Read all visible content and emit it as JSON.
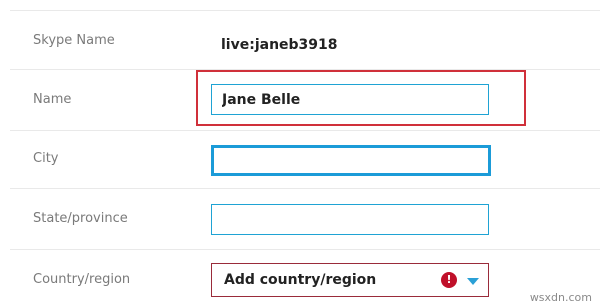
{
  "fields": {
    "skype_name": {
      "label": "Skype Name",
      "value": "live:janeb3918"
    },
    "name": {
      "label": "Name",
      "value": "Jane Belle"
    },
    "city": {
      "label": "City",
      "value": ""
    },
    "state": {
      "label": "State/province",
      "value": ""
    },
    "country": {
      "label": "Country/region",
      "value": "Add country/region",
      "error_icon": "exclamation-icon",
      "dropdown_icon": "chevron-down-icon"
    }
  },
  "watermark": "wsxdn.com",
  "colors": {
    "highlight_box": "#d0303a",
    "input_border": "#1fa3d4",
    "error": "#c0102a",
    "caret": "#2aa0d6"
  }
}
